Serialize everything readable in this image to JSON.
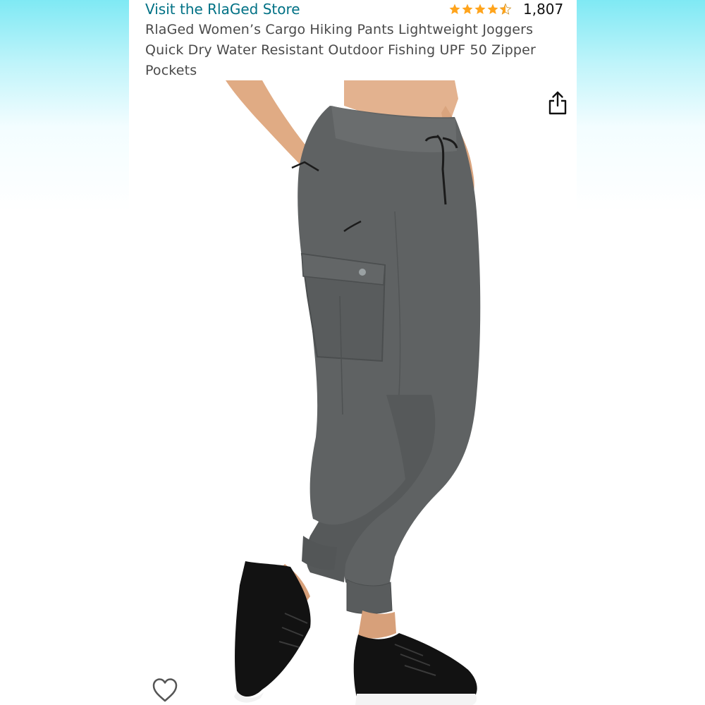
{
  "product": {
    "store_link": "Visit the RlaGed Store",
    "rating_count": "1,807",
    "rating_value": 4.5,
    "title": "RlaGed Women’s Cargo Hiking Pants Lightweight Joggers Quick Dry Water Resistant Outdoor Fishing UPF 50 Zipper Pockets"
  },
  "icons": {
    "rating": "star-icon",
    "share": "share-icon",
    "wishlist": "heart-icon"
  },
  "colors": {
    "link": "#007185",
    "star": "#ffa41c",
    "pants": "#5f6263",
    "shoes": "#121212"
  }
}
